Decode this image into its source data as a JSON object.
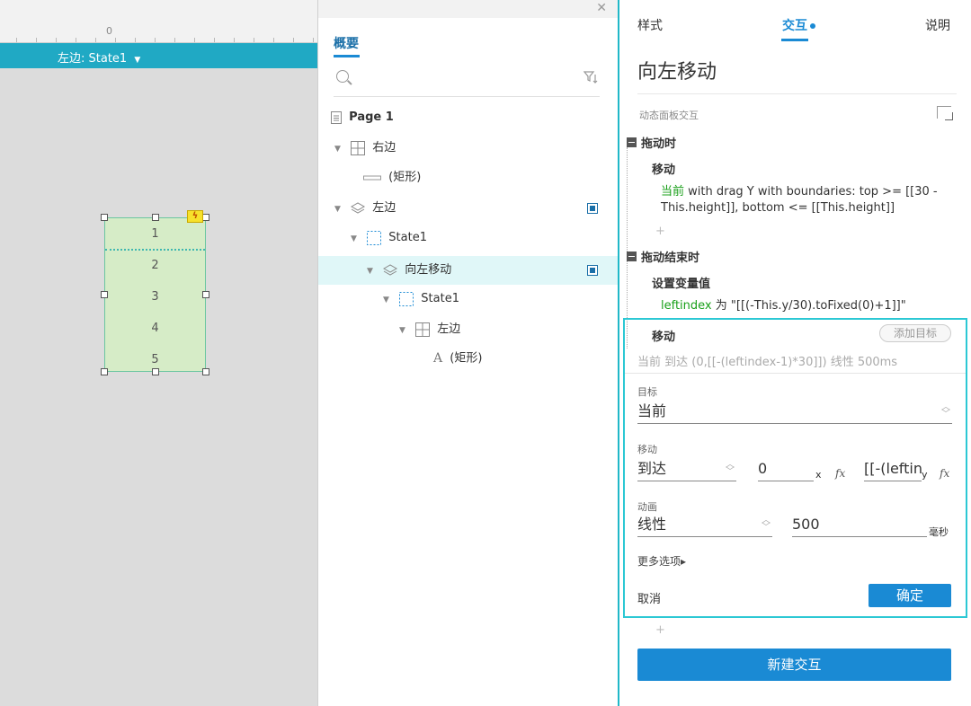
{
  "canvas": {
    "ruler_zero": "0",
    "state_label": "左边: State1",
    "panel_rows": [
      "1",
      "2",
      "3",
      "4",
      "5"
    ],
    "bolt_icon": "lightning-icon"
  },
  "outline": {
    "tab_label": "概要",
    "tree": [
      {
        "label": "Page 1",
        "icon": "page-icon"
      },
      {
        "label": "右边",
        "icon": "repeater-grid-icon"
      },
      {
        "label": "(矩形)",
        "icon": "rectangle-icon"
      },
      {
        "label": "左边",
        "icon": "dynamic-panel-icon"
      },
      {
        "label": "State1",
        "icon": "state-icon"
      },
      {
        "label": "向左移动",
        "icon": "dynamic-panel-icon"
      },
      {
        "label": "State1",
        "icon": "state-icon"
      },
      {
        "label": "左边",
        "icon": "repeater-grid-icon"
      },
      {
        "label": "(矩形)",
        "icon": "text-icon",
        "icon_glyph": "A"
      }
    ]
  },
  "inspector": {
    "tabs": [
      "样式",
      "交互",
      "说明"
    ],
    "active_tab": "交互",
    "title": "向左移动",
    "section_label": "动态面板交互",
    "event1": "拖动时",
    "action1_title": "移动",
    "action1_target": "当前",
    "action1_desc": " with drag Y  with boundaries: top >= [[30 - This.height]], bottom <= [[This.height]]",
    "event2": "拖动结束时",
    "action2_title": "设置变量值",
    "action2_var": "leftindex",
    "action2_desc": " 为 \"[[(-This.y/30).toFixed(0)+1]]\"",
    "edit": {
      "title": "移动",
      "add_target": "添加目标",
      "summary": "当前 到达 (0,[[-(leftindex-1)*30]]) 线性 500ms",
      "target_label": "目标",
      "target_value": "当前",
      "move_label": "移动",
      "move_mode": "到达",
      "x_value": "0",
      "x_axis": "x",
      "y_value": "[[-(leftin",
      "y_axis": "y",
      "fx": "fx",
      "anim_label": "动画",
      "anim_value": "线性",
      "duration": "500",
      "duration_unit": "毫秒",
      "more_options": "更多选项▸",
      "cancel": "取消",
      "confirm": "确定"
    },
    "plus": "+",
    "new_interaction": "新建交互"
  },
  "colors": {
    "accent": "#1a8ad4",
    "teal": "#20a9c4",
    "highlight_border": "#2cc8d4",
    "green_text": "#1aa01a"
  }
}
